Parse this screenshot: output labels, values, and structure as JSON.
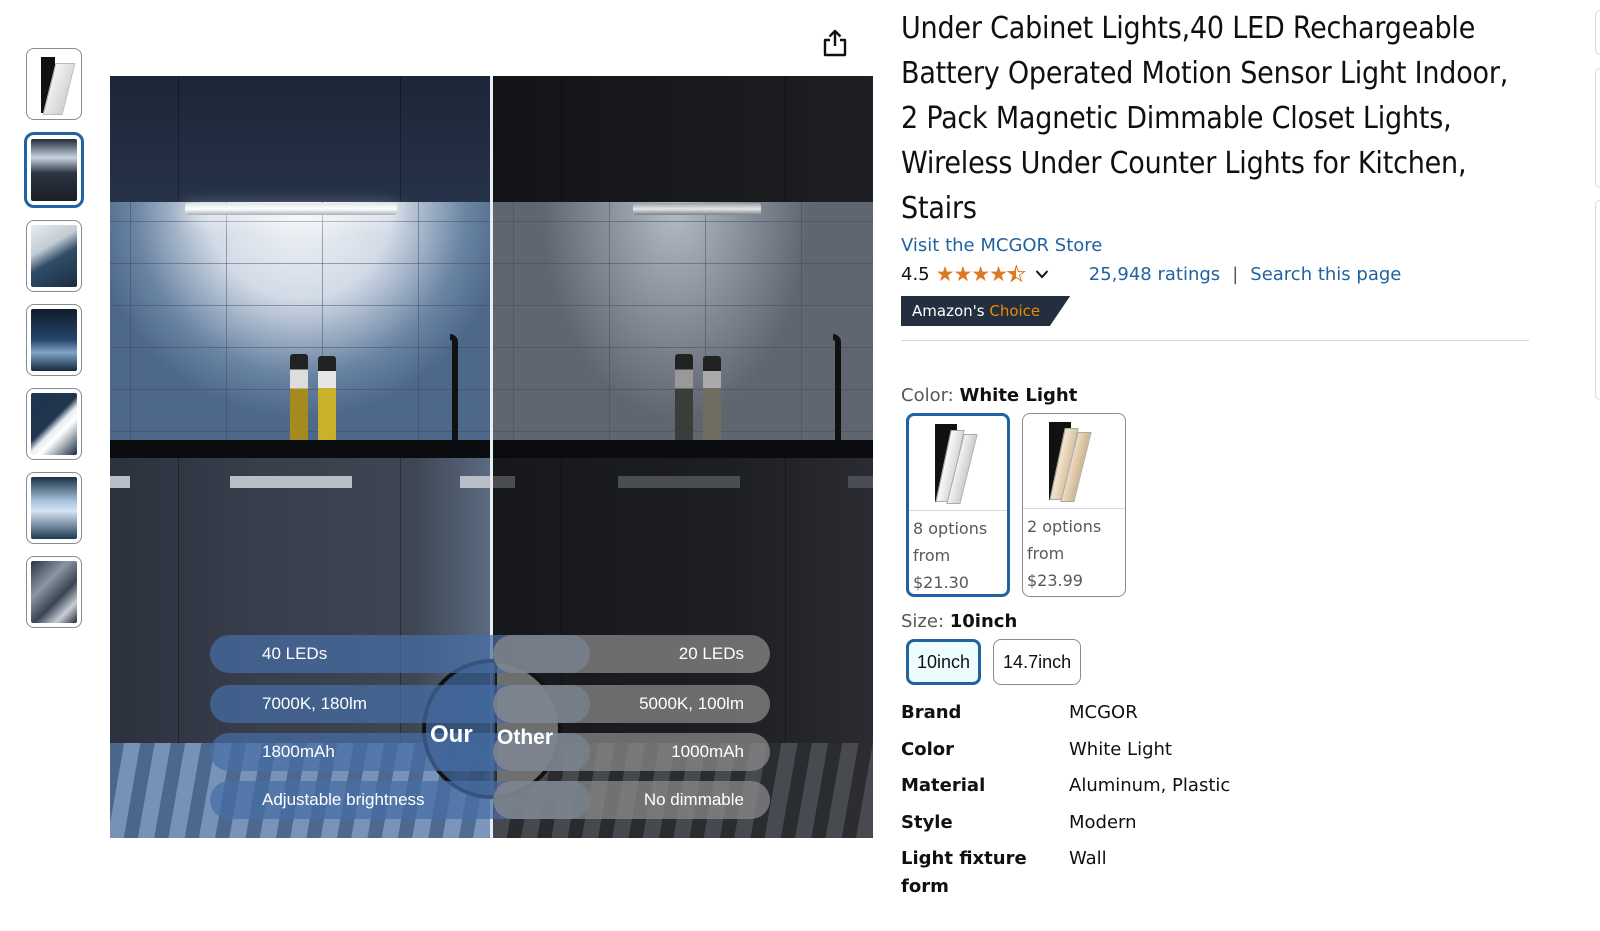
{
  "thumbnails": [
    {
      "name": "product-front",
      "selected": false
    },
    {
      "name": "comparison",
      "selected": true
    },
    {
      "name": "detail-closeup",
      "selected": false
    },
    {
      "name": "motion-sensor",
      "selected": false
    },
    {
      "name": "battery",
      "selected": false
    },
    {
      "name": "magnetic-install",
      "selected": false
    },
    {
      "name": "usage-scenes",
      "selected": false
    }
  ],
  "main_image": {
    "left_badge": "Our",
    "right_badge": "Other",
    "our_features": [
      "40 LEDs",
      "7000K, 180lm",
      "1800mAh",
      "Adjustable brightness"
    ],
    "other_features": [
      "20 LEDs",
      "5000K, 100lm",
      "1000mAh",
      "No dimmable"
    ]
  },
  "share_icon": "share-icon",
  "product": {
    "title": "Under Cabinet Lights,40 LED Rechargeable Battery Operated Motion Sensor Light Indoor, 2 Pack Magnetic Dimmable Closet Lights, Wireless Under Counter Lights for Kitchen, Stairs",
    "store_link": "Visit the MCGOR Store",
    "rating": "4.5",
    "rating_stars": 4.5,
    "ratings_count": "25,948 ratings",
    "separator": "|",
    "search_link": "Search this page",
    "badge_part1": "Amazon's",
    "badge_part2": "Choice",
    "colors": {
      "accent": "#2162a1",
      "star": "#de7921",
      "badge_bg": "#232f3e",
      "badge_highlight": "#f08804"
    }
  },
  "color_selector": {
    "label": "Color:",
    "selected": "White Light",
    "options": [
      {
        "line1": "8 options",
        "line2": "from",
        "price": "$21.30",
        "selected": true
      },
      {
        "line1": "2 options",
        "line2": "from",
        "price": "$23.99",
        "selected": false
      }
    ]
  },
  "size_selector": {
    "label": "Size:",
    "selected": "10inch",
    "options": [
      {
        "label": "10inch",
        "selected": true
      },
      {
        "label": "14.7inch",
        "selected": false
      }
    ]
  },
  "specs": [
    {
      "key": "Brand",
      "value": "MCGOR"
    },
    {
      "key": "Color",
      "value": "White Light"
    },
    {
      "key": "Material",
      "value": "Aluminum, Plastic"
    },
    {
      "key": "Style",
      "value": "Modern"
    },
    {
      "key": "Light fixture form",
      "value": "Wall"
    }
  ]
}
